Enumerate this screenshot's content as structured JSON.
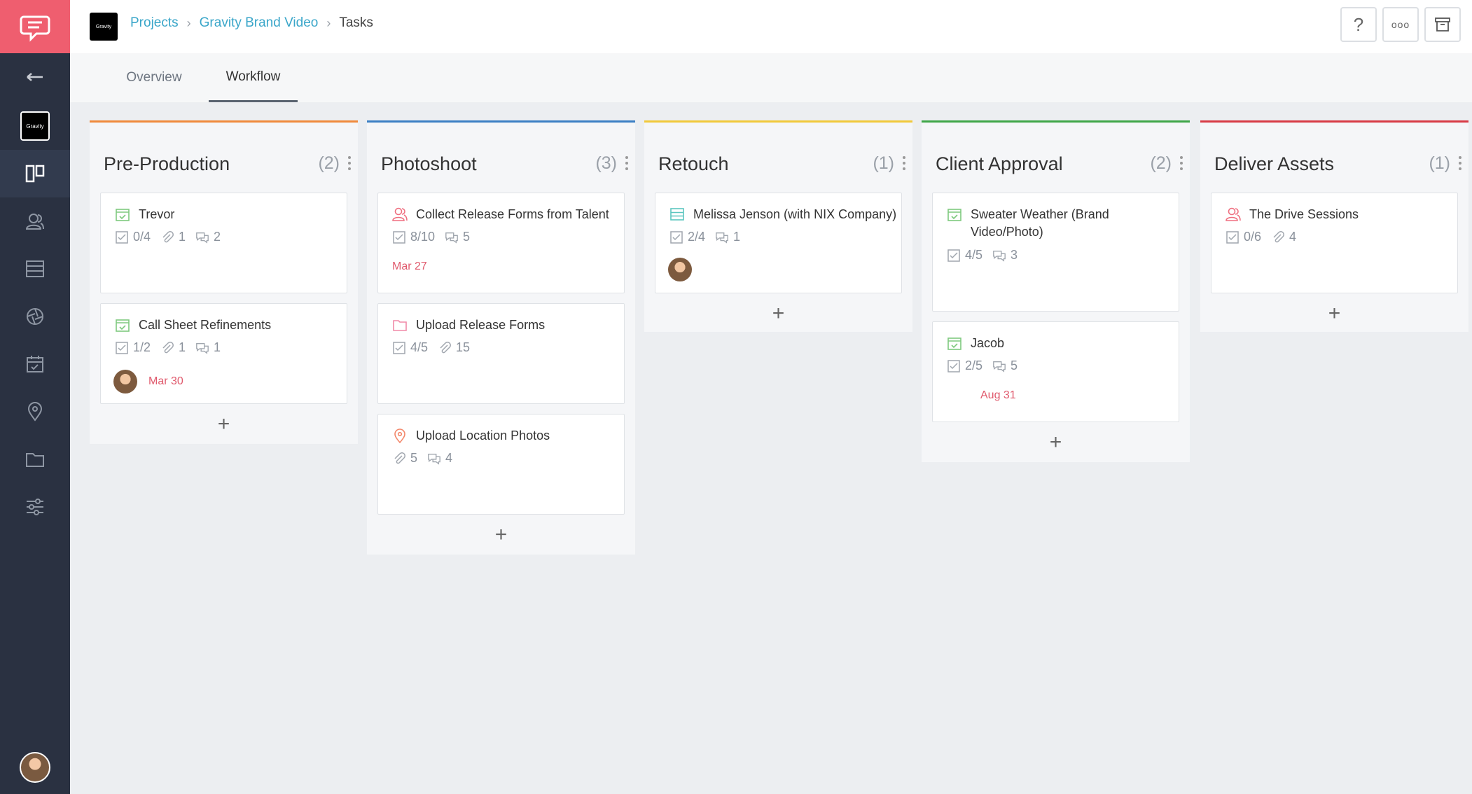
{
  "app": {
    "logo_icon": "chat-logo-icon",
    "brand_color": "#ef5e6f",
    "sidebar_bg": "#2a3141"
  },
  "project_thumb_label": "Gravity",
  "breadcrumb": {
    "projects": "Projects",
    "project": "Gravity Brand Video",
    "current": "Tasks"
  },
  "topbar": {
    "help_label": "?",
    "more_label": "ooo"
  },
  "tabs": [
    {
      "label": "Overview",
      "active": false
    },
    {
      "label": "Workflow",
      "active": true
    }
  ],
  "sidebar_icons": [
    "back-arrow-icon",
    "project-thumbnail",
    "board-icon",
    "contacts-icon",
    "list-icon",
    "aperture-icon",
    "calendar-icon",
    "location-icon",
    "folder-icon",
    "settings-sliders-icon"
  ],
  "columns": [
    {
      "title": "Pre-Production",
      "count": "(2)",
      "color": "#f08a3c",
      "cards": [
        {
          "title": "Trevor",
          "icon": "calendar-check-icon",
          "icon_color": "#7fc97f",
          "checklist": "0/4",
          "attachments": "1",
          "comments": "2"
        },
        {
          "title": "Call Sheet Refinements",
          "icon": "calendar-check-icon",
          "icon_color": "#7fc97f",
          "checklist": "1/2",
          "attachments": "1",
          "comments": "1",
          "due": "Mar 30"
        }
      ]
    },
    {
      "title": "Photoshoot",
      "count": "(3)",
      "color": "#3b7fc4",
      "cards": [
        {
          "title": "Collect Release Forms from Talent",
          "icon": "contacts-icon",
          "icon_color": "#ef6f80",
          "checklist": "8/10",
          "comments": "5",
          "due": "Mar 27"
        },
        {
          "title": "Upload Release Forms",
          "icon": "folder-icon",
          "icon_color": "#f08aa8",
          "checklist": "4/5",
          "attachments": "15"
        },
        {
          "title": "Upload Location Photos",
          "icon": "location-icon",
          "icon_color": "#f3876a",
          "attachments": "5",
          "comments": "4"
        }
      ]
    },
    {
      "title": "Retouch",
      "count": "(1)",
      "color": "#f1c93b",
      "cards": [
        {
          "title": "Melissa Jenson (with NIX Company)",
          "icon": "list-icon",
          "icon_color": "#5cc6c0",
          "checklist": "2/4",
          "comments": "1"
        }
      ]
    },
    {
      "title": "Client Approval",
      "count": "(2)",
      "color": "#3fa648",
      "cards": [
        {
          "title": "Sweater Weather (Brand Video/Photo)",
          "icon": "calendar-check-icon",
          "icon_color": "#7fc97f",
          "checklist": "4/5",
          "comments": "3"
        },
        {
          "title": "Jacob",
          "icon": "calendar-check-icon",
          "icon_color": "#7fc97f",
          "checklist": "2/5",
          "comments": "5",
          "due": "Aug 31"
        }
      ]
    },
    {
      "title": "Deliver Assets",
      "count": "(1)",
      "color": "#d83b45",
      "cards": [
        {
          "title": "The Drive Sessions",
          "icon": "contacts-icon",
          "icon_color": "#ef6f80",
          "checklist": "0/6",
          "attachments": "4"
        }
      ]
    }
  ],
  "add_label": "+"
}
